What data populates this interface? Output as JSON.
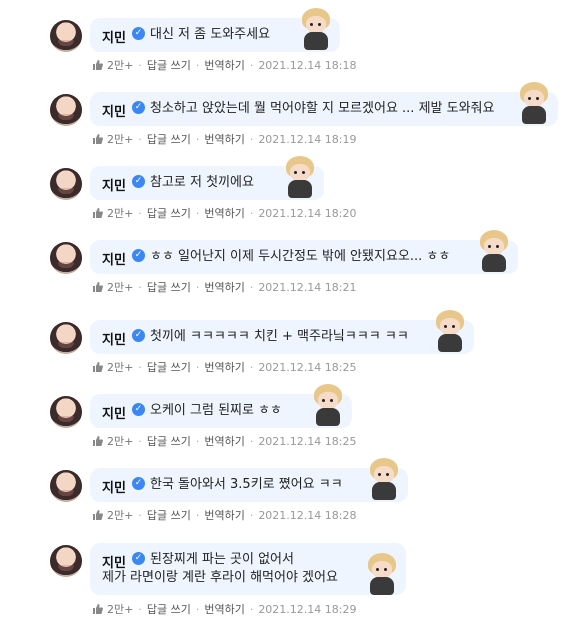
{
  "comments": [
    {
      "name": "지민",
      "text": "대신 저 좀 도와주세요",
      "likes": "2만+",
      "reply": "답글 쓰기",
      "translate": "번역하기",
      "date": "2021.12.14 18:18"
    },
    {
      "name": "지민",
      "text": "청소하고 앉았는데 뭘 먹어야할 지 모르겠어요 ... 제발 도와줘요",
      "likes": "2만+",
      "reply": "답글 쓰기",
      "translate": "번역하기",
      "date": "2021.12.14 18:19"
    },
    {
      "name": "지민",
      "text": "참고로 저 첫끼에요",
      "likes": "2만+",
      "reply": "답글 쓰기",
      "translate": "번역하기",
      "date": "2021.12.14 18:20"
    },
    {
      "name": "지민",
      "text": "ㅎㅎ 일어난지 이제 두시간정도 밖에 안됐지요오... ㅎㅎ",
      "likes": "2만+",
      "reply": "답글 쓰기",
      "translate": "번역하기",
      "date": "2021.12.14 18:21"
    },
    {
      "name": "지민",
      "text": "첫끼에 ㅋㅋㅋㅋㅋ 치킨 + 맥주라닠ㅋㅋㅋ ㅋㅋ",
      "likes": "2만+",
      "reply": "답글 쓰기",
      "translate": "번역하기",
      "date": "2021.12.14 18:25"
    },
    {
      "name": "지민",
      "text": "오케이 그럼 된찌로 ㅎㅎ",
      "likes": "2만+",
      "reply": "답글 쓰기",
      "translate": "번역하기",
      "date": "2021.12.14 18:25"
    },
    {
      "name": "지민",
      "text": "한국 돌아와서 3.5키로 쪘어요 ㅋㅋ",
      "likes": "2만+",
      "reply": "답글 쓰기",
      "translate": "번역하기",
      "date": "2021.12.14 18:28"
    },
    {
      "name": "지민",
      "text": "된장찌게 파는 곳이 없어서",
      "text2": "제가 라면이랑 계란 후라이 해먹어야 겠어요",
      "likes": "2만+",
      "reply": "답글 쓰기",
      "translate": "번역하기",
      "date": "2021.12.14 18:29"
    }
  ],
  "colors": {
    "bubble": "#eef5ff",
    "verify": "#3b87f3",
    "meta": "#777777"
  },
  "icons": {
    "like": "thumbs-up-icon",
    "verified": "verified-check-icon",
    "sticker": "character-sticker-icon"
  }
}
